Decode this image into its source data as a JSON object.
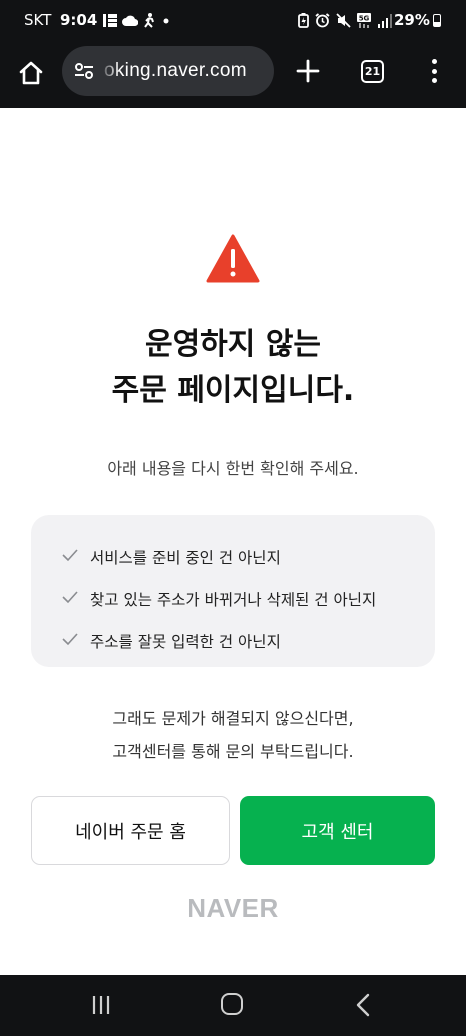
{
  "status_bar": {
    "carrier": "SKT",
    "time": "9:04",
    "battery_percent": "29%",
    "icons_left": [
      "gallery-icon",
      "cloud-icon",
      "person-walk-icon",
      "dot-icon"
    ],
    "icons_right": [
      "battery-saver-icon",
      "alarm-icon",
      "mute-icon",
      "5g-icon",
      "signal-icon"
    ]
  },
  "browser": {
    "url": "oking.naver.com",
    "tab_count": "21"
  },
  "content": {
    "title_line1": "운영하지 않는",
    "title_line2": "주문 페이지입니다.",
    "sub_message": "아래 내용을 다시 한번 확인해 주세요.",
    "check_items": [
      "서비스를 준비 중인 건 아닌지",
      "찾고 있는 주소가 바뀌거나 삭제된 건 아닌지",
      "주소를 잘못 입력한 건 아닌지"
    ],
    "help_line1": "그래도 문제가 해결되지 않으신다면,",
    "help_line2": "고객센터를 통해 문의 부탁드립니다.",
    "buttons": {
      "naver_order_home": "네이버 주문 홈",
      "customer_center": "고객 센터"
    },
    "logo_text": "NAVER"
  },
  "colors": {
    "accent_green": "#06b14f",
    "warning_red": "#e8402b",
    "chrome_dark": "#111214"
  }
}
